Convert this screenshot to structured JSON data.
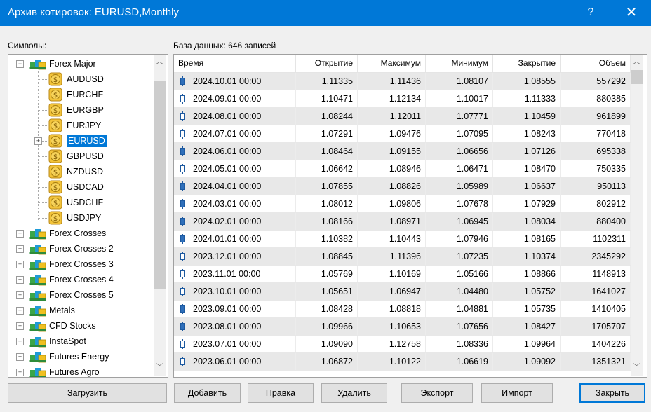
{
  "window": {
    "title": "Архив котировок: EURUSD,Monthly",
    "help_glyph": "?",
    "close_glyph": "✕"
  },
  "symbols_label": "Символы:",
  "db_label": "База данных: 646 записей",
  "tree": {
    "groups": [
      {
        "label": "Forex Major",
        "expanded": true
      },
      {
        "label": "Forex Crosses"
      },
      {
        "label": "Forex Crosses 2"
      },
      {
        "label": "Forex Crosses 3"
      },
      {
        "label": "Forex Crosses 4"
      },
      {
        "label": "Forex Crosses 5"
      },
      {
        "label": "Metals"
      },
      {
        "label": "CFD Stocks"
      },
      {
        "label": "InstaSpot"
      },
      {
        "label": "Futures Energy"
      },
      {
        "label": "Futures Agro"
      }
    ],
    "symbols": [
      "AUDUSD",
      "EURCHF",
      "EURGBP",
      "EURJPY",
      "EURUSD",
      "GBPUSD",
      "NZDUSD",
      "USDCAD",
      "USDCHF",
      "USDJPY"
    ],
    "selected": "EURUSD"
  },
  "columns": [
    "Время",
    "Открытие",
    "Максимум",
    "Минимум",
    "Закрытие",
    "Объем"
  ],
  "rows": [
    {
      "time": "2024.10.01 00:00",
      "open": "1.11335",
      "high": "1.11436",
      "low": "1.08107",
      "close": "1.08555",
      "vol": "557292",
      "bear": true
    },
    {
      "time": "2024.09.01 00:00",
      "open": "1.10471",
      "high": "1.12134",
      "low": "1.10017",
      "close": "1.11333",
      "vol": "880385",
      "bear": false
    },
    {
      "time": "2024.08.01 00:00",
      "open": "1.08244",
      "high": "1.12011",
      "low": "1.07771",
      "close": "1.10459",
      "vol": "961899",
      "bear": false
    },
    {
      "time": "2024.07.01 00:00",
      "open": "1.07291",
      "high": "1.09476",
      "low": "1.07095",
      "close": "1.08243",
      "vol": "770418",
      "bear": false
    },
    {
      "time": "2024.06.01 00:00",
      "open": "1.08464",
      "high": "1.09155",
      "low": "1.06656",
      "close": "1.07126",
      "vol": "695338",
      "bear": true
    },
    {
      "time": "2024.05.01 00:00",
      "open": "1.06642",
      "high": "1.08946",
      "low": "1.06471",
      "close": "1.08470",
      "vol": "750335",
      "bear": false
    },
    {
      "time": "2024.04.01 00:00",
      "open": "1.07855",
      "high": "1.08826",
      "low": "1.05989",
      "close": "1.06637",
      "vol": "950113",
      "bear": true
    },
    {
      "time": "2024.03.01 00:00",
      "open": "1.08012",
      "high": "1.09806",
      "low": "1.07678",
      "close": "1.07929",
      "vol": "802912",
      "bear": true
    },
    {
      "time": "2024.02.01 00:00",
      "open": "1.08166",
      "high": "1.08971",
      "low": "1.06945",
      "close": "1.08034",
      "vol": "880400",
      "bear": true
    },
    {
      "time": "2024.01.01 00:00",
      "open": "1.10382",
      "high": "1.10443",
      "low": "1.07946",
      "close": "1.08165",
      "vol": "1102311",
      "bear": true
    },
    {
      "time": "2023.12.01 00:00",
      "open": "1.08845",
      "high": "1.11396",
      "low": "1.07235",
      "close": "1.10374",
      "vol": "2345292",
      "bear": false
    },
    {
      "time": "2023.11.01 00:00",
      "open": "1.05769",
      "high": "1.10169",
      "low": "1.05166",
      "close": "1.08866",
      "vol": "1148913",
      "bear": false
    },
    {
      "time": "2023.10.01 00:00",
      "open": "1.05651",
      "high": "1.06947",
      "low": "1.04480",
      "close": "1.05752",
      "vol": "1641027",
      "bear": false
    },
    {
      "time": "2023.09.01 00:00",
      "open": "1.08428",
      "high": "1.08818",
      "low": "1.04881",
      "close": "1.05735",
      "vol": "1410405",
      "bear": true
    },
    {
      "time": "2023.08.01 00:00",
      "open": "1.09966",
      "high": "1.10653",
      "low": "1.07656",
      "close": "1.08427",
      "vol": "1705707",
      "bear": true
    },
    {
      "time": "2023.07.01 00:00",
      "open": "1.09090",
      "high": "1.12758",
      "low": "1.08336",
      "close": "1.09964",
      "vol": "1404226",
      "bear": false
    },
    {
      "time": "2023.06.01 00:00",
      "open": "1.06872",
      "high": "1.10122",
      "low": "1.06619",
      "close": "1.09092",
      "vol": "1351321",
      "bear": false
    }
  ],
  "buttons": {
    "load": "Загрузить",
    "add": "Добавить",
    "edit": "Правка",
    "delete": "Удалить",
    "export": "Экспорт",
    "import": "Импорт",
    "close": "Закрыть"
  },
  "colors": {
    "titlebar": "#0078d7",
    "candle_bear": "#2f6fba",
    "candle_bull": "#ffffff",
    "selection": "#0078d7"
  }
}
